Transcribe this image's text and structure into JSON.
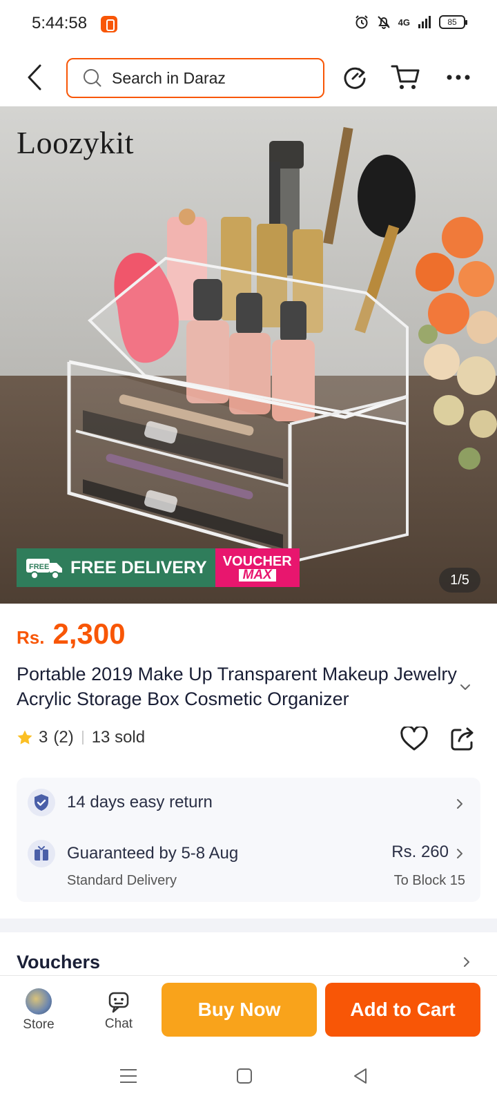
{
  "status_bar": {
    "time": "5:44:58",
    "network": "4G",
    "battery": "85",
    "icons": [
      "alarm-icon",
      "bell-muted-icon",
      "signal-icon",
      "battery-icon"
    ]
  },
  "header": {
    "search_placeholder": "Search in Daraz",
    "icons": [
      "back-arrow-icon",
      "search-icon",
      "share-refresh-icon",
      "cart-icon",
      "more-icon"
    ]
  },
  "hero": {
    "brand": "Loozykit",
    "free_delivery": "FREE DELIVERY",
    "free_tag": "FREE",
    "voucher_top": "VOUCHER",
    "voucher_bottom": "MAX",
    "counter": "1/5"
  },
  "product": {
    "currency": "Rs.",
    "price": "2,300",
    "title": "Portable 2019 Make Up Transparent Makeup Jewelry Acrylic Storage Box Cosmetic Organizer",
    "rating": "3",
    "rating_count": "(2)",
    "sold": "13 sold"
  },
  "service": {
    "return_text": "14 days easy return",
    "delivery_text": "Guaranteed by 5-8 Aug",
    "delivery_type": "Standard Delivery",
    "delivery_fee": "Rs. 260",
    "delivery_to": "To Block 15"
  },
  "vouchers": {
    "title": "Vouchers"
  },
  "bottom_bar": {
    "store_label": "Store",
    "chat_label": "Chat",
    "buy_now": "Buy Now",
    "add_to_cart": "Add to Cart"
  },
  "colors": {
    "accent": "#f85606",
    "buy_now": "#f9a31b",
    "free_delivery": "#2f7d5b",
    "voucher": "#e8166e"
  }
}
